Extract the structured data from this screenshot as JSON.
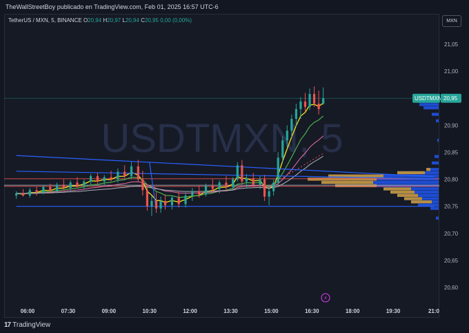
{
  "header": {
    "publisher_line": "TheWallStreetBoy publicado en TradingView.com, Feb 01, 2025 16:57 UTC-6"
  },
  "legend": {
    "symbol": "TetherUS / MXN, 5, BINANCE",
    "open_label": "O",
    "open": "20,94",
    "high_label": "H",
    "high": "20,97",
    "low_label": "L",
    "low": "20,94",
    "close_label": "C",
    "close": "20,95",
    "change": "0,00 (0,00%)"
  },
  "currency_button": "MXN",
  "watermark": "USDTMXN, 5",
  "price_tag": {
    "symbol": "USDTMXN",
    "price": "20,95"
  },
  "footer": {
    "brand_mark": "17",
    "brand": "TradingView"
  },
  "colors": {
    "background": "#131722",
    "up": "#26a69a",
    "down": "#ef5350",
    "price_line": "#26a69a",
    "trendline": "#2962ff",
    "ema_fast": "#f5e61f",
    "ema_mid": "#4caf50",
    "profile_blue": "#1e53e5",
    "profile_orange": "#c89632"
  },
  "chart_data": {
    "type": "candlestick",
    "x_ticks": [
      "06:00",
      "07:30",
      "09:00",
      "10:30",
      "12:00",
      "13:30",
      "15:00",
      "16:30",
      "18:00",
      "19:30",
      "21:0"
    ],
    "y_ticks": [
      "21,05",
      "21,00",
      "20,95",
      "20,90",
      "20,85",
      "20,80",
      "20,75",
      "20,70",
      "20,65",
      "20,60"
    ],
    "y_tick_values": [
      21.05,
      21.0,
      20.95,
      20.9,
      20.85,
      20.8,
      20.75,
      20.7,
      20.65,
      20.6
    ],
    "ylim": [
      20.575,
      21.085
    ],
    "x_range_hours": [
      5.5,
      21.1
    ],
    "last_price": 20.95,
    "candles": [
      {
        "t": "05:35",
        "o": 20.77,
        "h": 20.778,
        "l": 20.764,
        "c": 20.774
      },
      {
        "t": "05:50",
        "o": 20.774,
        "h": 20.782,
        "l": 20.768,
        "c": 20.77
      },
      {
        "t": "06:05",
        "o": 20.77,
        "h": 20.784,
        "l": 20.766,
        "c": 20.78
      },
      {
        "t": "06:20",
        "o": 20.78,
        "h": 20.786,
        "l": 20.77,
        "c": 20.776
      },
      {
        "t": "06:35",
        "o": 20.776,
        "h": 20.79,
        "l": 20.772,
        "c": 20.786
      },
      {
        "t": "06:50",
        "o": 20.786,
        "h": 20.792,
        "l": 20.774,
        "c": 20.778
      },
      {
        "t": "07:05",
        "o": 20.778,
        "h": 20.794,
        "l": 20.774,
        "c": 20.79
      },
      {
        "t": "07:20",
        "o": 20.79,
        "h": 20.8,
        "l": 20.78,
        "c": 20.784
      },
      {
        "t": "07:35",
        "o": 20.784,
        "h": 20.798,
        "l": 20.778,
        "c": 20.794
      },
      {
        "t": "07:50",
        "o": 20.794,
        "h": 20.804,
        "l": 20.784,
        "c": 20.788
      },
      {
        "t": "08:05",
        "o": 20.788,
        "h": 20.8,
        "l": 20.782,
        "c": 20.796
      },
      {
        "t": "08:20",
        "o": 20.796,
        "h": 20.81,
        "l": 20.788,
        "c": 20.806
      },
      {
        "t": "08:35",
        "o": 20.806,
        "h": 20.812,
        "l": 20.792,
        "c": 20.796
      },
      {
        "t": "08:50",
        "o": 20.796,
        "h": 20.808,
        "l": 20.79,
        "c": 20.804
      },
      {
        "t": "09:05",
        "o": 20.804,
        "h": 20.816,
        "l": 20.796,
        "c": 20.8
      },
      {
        "t": "09:20",
        "o": 20.8,
        "h": 20.82,
        "l": 20.794,
        "c": 20.814
      },
      {
        "t": "09:35",
        "o": 20.814,
        "h": 20.826,
        "l": 20.802,
        "c": 20.806
      },
      {
        "t": "09:50",
        "o": 20.806,
        "h": 20.832,
        "l": 20.8,
        "c": 20.824
      },
      {
        "t": "10:05",
        "o": 20.824,
        "h": 20.836,
        "l": 20.796,
        "c": 20.8
      },
      {
        "t": "10:15",
        "o": 20.8,
        "h": 20.816,
        "l": 20.77,
        "c": 20.78
      },
      {
        "t": "10:25",
        "o": 20.78,
        "h": 20.79,
        "l": 20.742,
        "c": 20.75
      },
      {
        "t": "10:35",
        "o": 20.75,
        "h": 20.77,
        "l": 20.732,
        "c": 20.76
      },
      {
        "t": "10:45",
        "o": 20.76,
        "h": 20.776,
        "l": 20.738,
        "c": 20.746
      },
      {
        "t": "10:55",
        "o": 20.746,
        "h": 20.768,
        "l": 20.738,
        "c": 20.76
      },
      {
        "t": "11:05",
        "o": 20.76,
        "h": 20.772,
        "l": 20.744,
        "c": 20.752
      },
      {
        "t": "11:20",
        "o": 20.752,
        "h": 20.77,
        "l": 20.744,
        "c": 20.766
      },
      {
        "t": "11:35",
        "o": 20.766,
        "h": 20.778,
        "l": 20.748,
        "c": 20.754
      },
      {
        "t": "11:50",
        "o": 20.754,
        "h": 20.776,
        "l": 20.748,
        "c": 20.77
      },
      {
        "t": "12:05",
        "o": 20.77,
        "h": 20.784,
        "l": 20.76,
        "c": 20.778
      },
      {
        "t": "12:20",
        "o": 20.778,
        "h": 20.788,
        "l": 20.766,
        "c": 20.772
      },
      {
        "t": "12:35",
        "o": 20.772,
        "h": 20.792,
        "l": 20.768,
        "c": 20.788
      },
      {
        "t": "12:50",
        "o": 20.788,
        "h": 20.8,
        "l": 20.776,
        "c": 20.782
      },
      {
        "t": "13:05",
        "o": 20.782,
        "h": 20.798,
        "l": 20.774,
        "c": 20.794
      },
      {
        "t": "13:20",
        "o": 20.794,
        "h": 20.806,
        "l": 20.78,
        "c": 20.786
      },
      {
        "t": "13:35",
        "o": 20.786,
        "h": 20.804,
        "l": 20.78,
        "c": 20.8
      },
      {
        "t": "13:45",
        "o": 20.8,
        "h": 20.832,
        "l": 20.796,
        "c": 20.826
      },
      {
        "t": "13:55",
        "o": 20.826,
        "h": 20.836,
        "l": 20.79,
        "c": 20.796
      },
      {
        "t": "14:05",
        "o": 20.796,
        "h": 20.81,
        "l": 20.784,
        "c": 20.802
      },
      {
        "t": "14:20",
        "o": 20.802,
        "h": 20.812,
        "l": 20.786,
        "c": 20.79
      },
      {
        "t": "14:35",
        "o": 20.79,
        "h": 20.806,
        "l": 20.782,
        "c": 20.8
      },
      {
        "t": "14:45",
        "o": 20.8,
        "h": 20.808,
        "l": 20.76,
        "c": 20.768
      },
      {
        "t": "14:55",
        "o": 20.768,
        "h": 20.784,
        "l": 20.752,
        "c": 20.778
      },
      {
        "t": "15:05",
        "o": 20.778,
        "h": 20.8,
        "l": 20.77,
        "c": 20.794
      },
      {
        "t": "15:15",
        "o": 20.794,
        "h": 20.85,
        "l": 20.79,
        "c": 20.84
      },
      {
        "t": "15:25",
        "o": 20.84,
        "h": 20.88,
        "l": 20.832,
        "c": 20.872
      },
      {
        "t": "15:35",
        "o": 20.872,
        "h": 20.9,
        "l": 20.86,
        "c": 20.89
      },
      {
        "t": "15:45",
        "o": 20.89,
        "h": 20.92,
        "l": 20.878,
        "c": 20.912
      },
      {
        "t": "15:55",
        "o": 20.912,
        "h": 20.94,
        "l": 20.898,
        "c": 20.93
      },
      {
        "t": "16:05",
        "o": 20.93,
        "h": 20.952,
        "l": 20.912,
        "c": 20.944
      },
      {
        "t": "16:15",
        "o": 20.944,
        "h": 20.96,
        "l": 20.926,
        "c": 20.934
      },
      {
        "t": "16:25",
        "o": 20.934,
        "h": 20.968,
        "l": 20.928,
        "c": 20.958
      },
      {
        "t": "16:35",
        "o": 20.958,
        "h": 20.972,
        "l": 20.934,
        "c": 20.94
      },
      {
        "t": "16:45",
        "o": 20.94,
        "h": 20.964,
        "l": 20.92,
        "c": 20.93
      },
      {
        "t": "16:55",
        "o": 20.94,
        "h": 20.97,
        "l": 20.938,
        "c": 20.95
      }
    ],
    "trendlines": [
      {
        "from": [
          "05:35",
          20.844
        ],
        "to": [
          "21:00",
          20.805
        ]
      },
      {
        "from": [
          "05:35",
          20.815
        ],
        "to": [
          "21:00",
          20.801
        ]
      },
      {
        "from": [
          "10:30",
          20.832
        ],
        "to": [
          "10:45",
          20.744
        ]
      },
      {
        "from": [
          "05:35",
          20.75
        ],
        "to": [
          "21:00",
          20.75
        ]
      }
    ],
    "h_levels": [
      {
        "y": 20.801,
        "color": "#ef5350"
      },
      {
        "y": 20.789,
        "color": "#b2b5be"
      },
      {
        "y": 20.787,
        "color": "#ef5350"
      }
    ],
    "volume_profile": [
      {
        "lo": 20.947,
        "hi": 20.953,
        "blue": 32,
        "orange": 0
      },
      {
        "lo": 20.941,
        "hi": 20.947,
        "blue": 30,
        "orange": 0
      },
      {
        "lo": 20.935,
        "hi": 20.941,
        "blue": 28,
        "orange": 0
      },
      {
        "lo": 20.929,
        "hi": 20.935,
        "blue": 22,
        "orange": 0
      },
      {
        "lo": 20.917,
        "hi": 20.923,
        "blue": 10,
        "orange": 0
      },
      {
        "lo": 20.905,
        "hi": 20.911,
        "blue": 4,
        "orange": 0
      },
      {
        "lo": 20.869,
        "hi": 20.875,
        "blue": 2,
        "orange": 0
      },
      {
        "lo": 20.839,
        "hi": 20.845,
        "blue": 6,
        "orange": 0
      },
      {
        "lo": 20.827,
        "hi": 20.833,
        "blue": 10,
        "orange": 0
      },
      {
        "lo": 20.815,
        "hi": 20.821,
        "blue": 18,
        "orange": 6
      },
      {
        "lo": 20.809,
        "hi": 20.815,
        "blue": 60,
        "orange": 40
      },
      {
        "lo": 20.803,
        "hi": 20.809,
        "blue": 160,
        "orange": 80
      },
      {
        "lo": 20.797,
        "hi": 20.803,
        "blue": 190,
        "orange": 100
      },
      {
        "lo": 20.791,
        "hi": 20.797,
        "blue": 170,
        "orange": 75
      },
      {
        "lo": 20.785,
        "hi": 20.791,
        "blue": 150,
        "orange": 60
      },
      {
        "lo": 20.779,
        "hi": 20.785,
        "blue": 80,
        "orange": 40
      },
      {
        "lo": 20.773,
        "hi": 20.779,
        "blue": 70,
        "orange": 35
      },
      {
        "lo": 20.767,
        "hi": 20.773,
        "blue": 60,
        "orange": 30
      },
      {
        "lo": 20.761,
        "hi": 20.767,
        "blue": 50,
        "orange": 26
      },
      {
        "lo": 20.755,
        "hi": 20.761,
        "blue": 40,
        "orange": 30
      },
      {
        "lo": 20.749,
        "hi": 20.755,
        "blue": 30,
        "orange": 0
      },
      {
        "lo": 20.743,
        "hi": 20.749,
        "blue": 12,
        "orange": 0
      },
      {
        "lo": 20.725,
        "hi": 20.731,
        "blue": 4,
        "orange": 0
      }
    ],
    "grid": false
  }
}
